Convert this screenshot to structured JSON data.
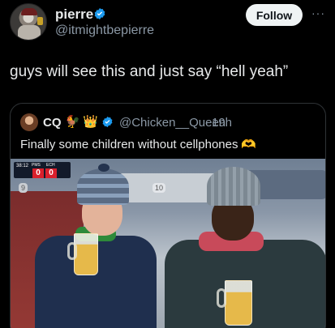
{
  "author": {
    "display_name": "pierre",
    "handle": "@itmightbepierre",
    "verified": true
  },
  "actions": {
    "follow_label": "Follow",
    "more_label": "···"
  },
  "tweet": {
    "text": "guys will see this and just say “hell yeah”"
  },
  "quoted_tweet": {
    "display_name": "CQ",
    "name_emojis": [
      "🐓",
      "👑"
    ],
    "verified": true,
    "handle": "@Chicken__Queen",
    "separator": "·",
    "time": "19h",
    "text": "Finally some children without cellphones",
    "text_emoji": "🫶",
    "photo": {
      "scoreboard": {
        "clock": "38:12",
        "team1": "PMS",
        "team2": "ECH",
        "score1": "0",
        "score2": "0"
      },
      "seat_number_left": "9",
      "seat_number_center": "10"
    }
  },
  "colors": {
    "background": "#000000",
    "text_primary": "#e7e9ea",
    "text_secondary": "#8b98a5",
    "verified_blue": "#1d9bf0",
    "follow_bg": "#eff3f4",
    "border": "#2f3336"
  }
}
